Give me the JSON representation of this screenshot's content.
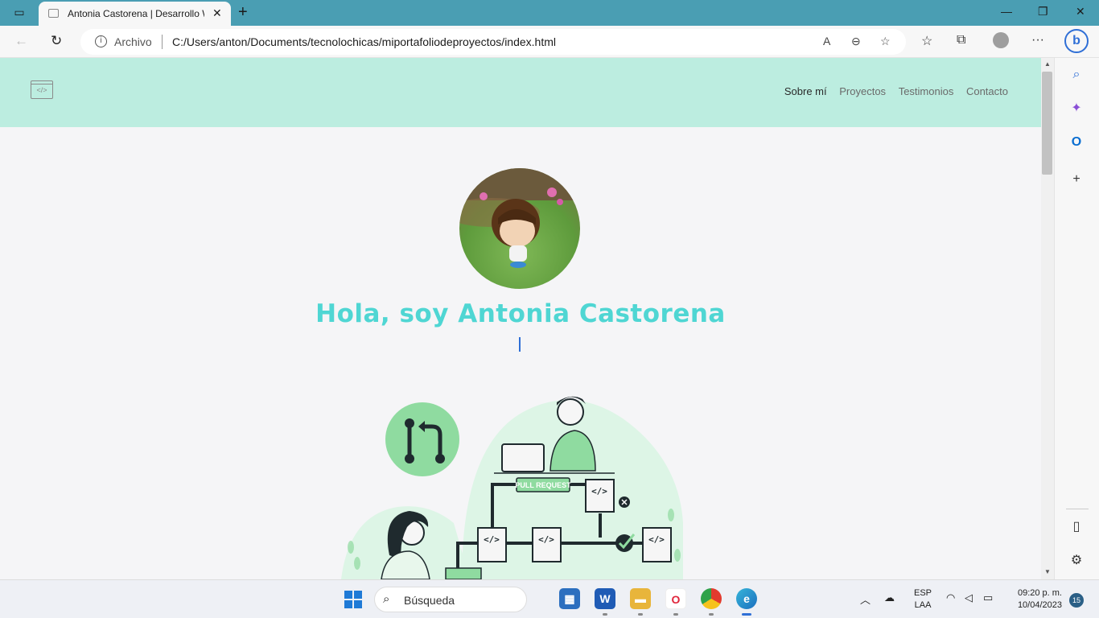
{
  "browser": {
    "tab_title": "Antonia Castorena | Desarrollo W",
    "address_prefix": "Archivo",
    "url": "C:/Users/anton/Documents/tecnolochicas/miportafoliodeproyectos/index.html"
  },
  "page": {
    "logo_glyph": "</>",
    "nav": [
      "Sobre mí",
      "Proyectos",
      "Testimonios",
      "Contacto"
    ],
    "active_nav": "Sobre mí",
    "heading": "Hola, soy Antonia Castorena",
    "illustration_label": "PULL REQUEST",
    "accent_color": "#4fd6d3",
    "header_color": "#bcede0"
  },
  "taskbar": {
    "search_placeholder": "Búsqueda",
    "lang_line1": "ESP",
    "lang_line2": "LAA",
    "time": "09:20 p. m.",
    "date": "10/04/2023",
    "notifications": "15"
  }
}
